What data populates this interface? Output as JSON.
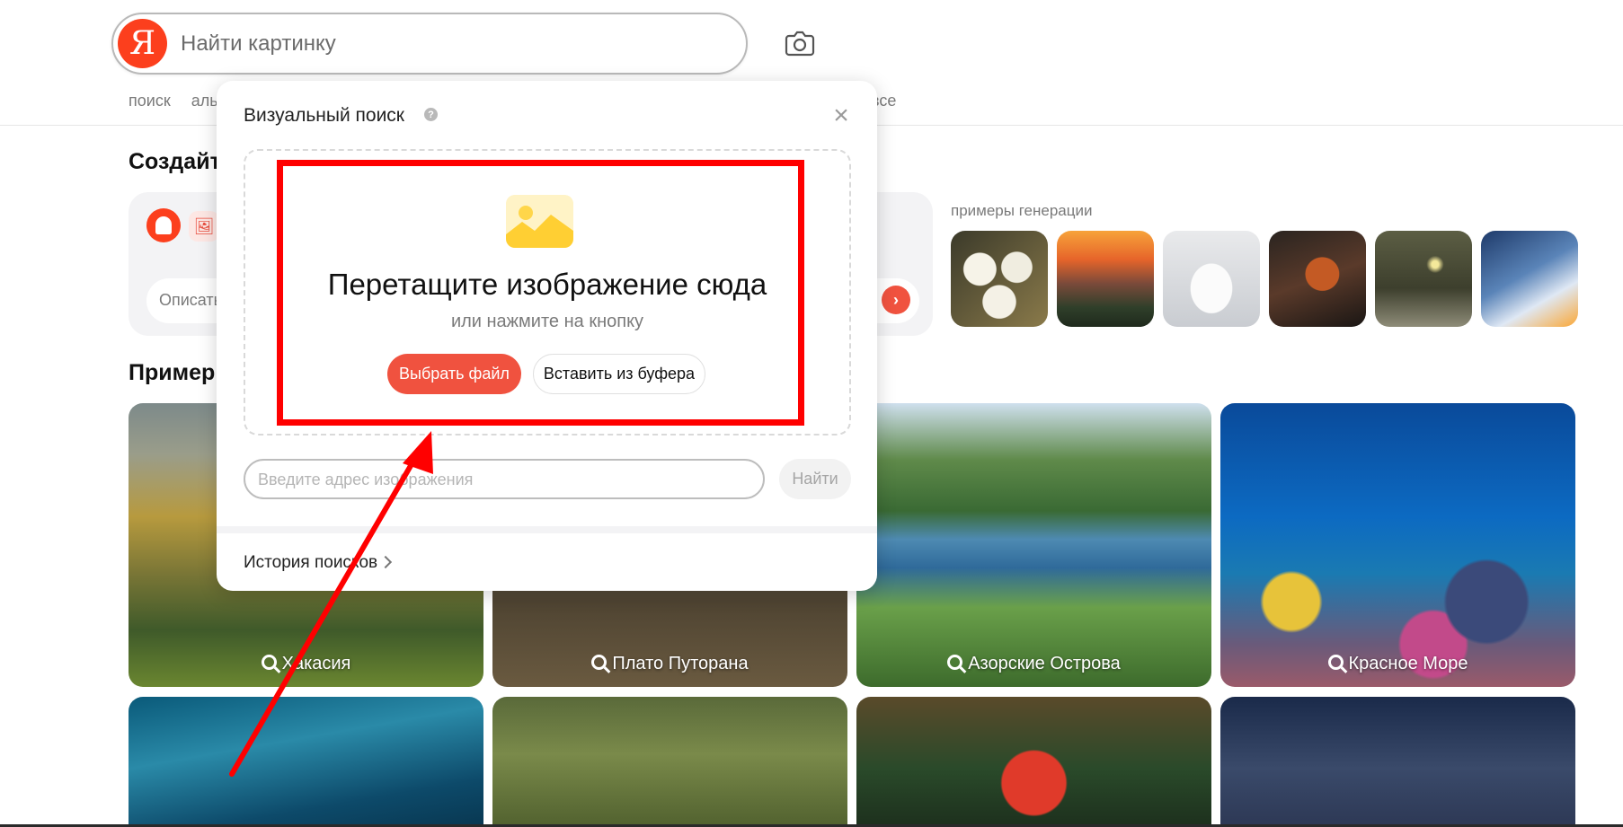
{
  "header": {
    "logo_letter": "Я",
    "search_placeholder": "Найти картинку",
    "nav_left": [
      "поиск",
      "аль"
    ],
    "nav_right": "все"
  },
  "sections": {
    "create_title": "Создайт",
    "describe_placeholder": "Описать",
    "examples_label": "примеры генерации",
    "popular_title": "Пример"
  },
  "tiles": [
    {
      "label": "Хакасия"
    },
    {
      "label": "Плато Путорана"
    },
    {
      "label": "Азорские Острова"
    },
    {
      "label": "Красное Море"
    }
  ],
  "modal": {
    "title": "Визуальный поиск",
    "help": "?",
    "close": "×",
    "drop_title": "Перетащите изображение сюда",
    "drop_subtitle": "или нажмите на кнопку",
    "choose_file": "Выбрать файл",
    "paste_clipboard": "Вставить из буфера",
    "url_placeholder": "Введите адрес изображения",
    "find": "Найти",
    "history": "История поисков"
  },
  "colors": {
    "accent": "#f0523f",
    "logo": "#fc3f1d",
    "annotation": "#ff0000"
  }
}
